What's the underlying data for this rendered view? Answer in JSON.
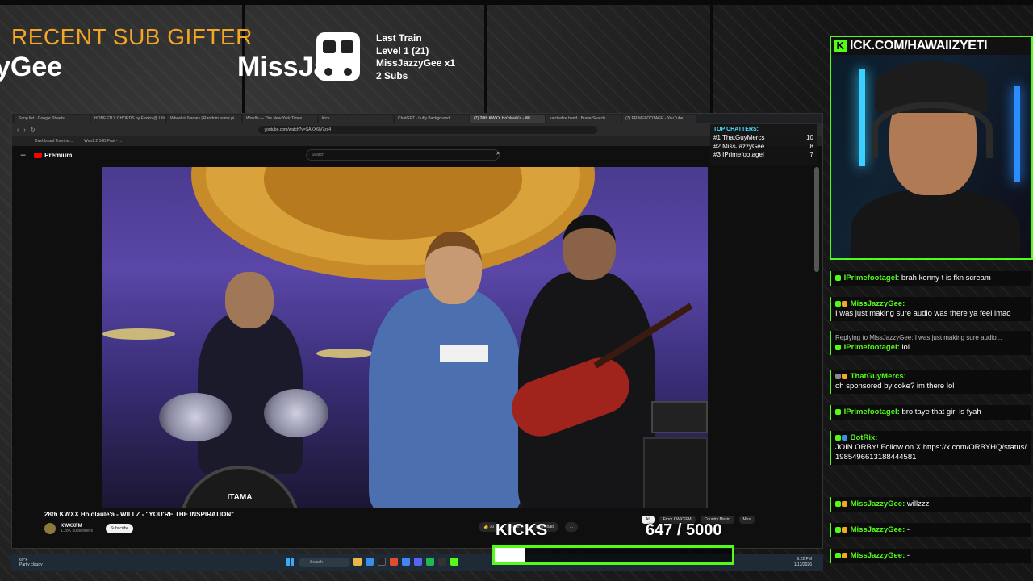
{
  "overlay": {
    "sub_gifter_title": "RECENT SUB GIFTER",
    "sub_gifter_name_left": "yGee",
    "sub_gifter_name_right": "MissJa",
    "train": {
      "title": "Last Train",
      "level": "Level 1  (21)",
      "gifter": "MissJazzyGee x1",
      "subs": "2 Subs"
    },
    "kick_url": "ICK.COM/HAWAIIZYETI",
    "kicks_label": "KICKS",
    "kicks_count": "647 / 5000",
    "kicks_progress": 0.1294
  },
  "browser": {
    "tabs": [
      "Song list - Google Sheets",
      "HONESTLY CHORDS by Eaoko @ Ulti",
      "Wheel of Names | Random name pi",
      "Wordle — The New York Times",
      "Kick",
      "ChatGPT - Luffy Background",
      "(7) 28th KWXX Ho'olaule'a - WI",
      "katchafire band - Brave Search",
      "(7) PRIMEFOOTAGE - YouTube"
    ],
    "active_tab_index": 6,
    "url": "youtube.com/watch?v=SAXX6lV7zc4",
    "bookmarks": [
      "Dashboard Tourthw...",
      "Wan2.2 14B Fast - ..."
    ]
  },
  "youtube": {
    "logo_text": "Premium",
    "search_placeholder": "Search",
    "video_title": "28th KWXX Ho'olaule'a - WILLZ - \"YOU'RE THE INSPIRATION\"",
    "channel_name": "KWXXFM",
    "channel_subs": "1.28K subscribers",
    "subscribe_label": "Subscribe",
    "like_count": "30",
    "save_label": "Save",
    "download_label": "Download",
    "more_label": "...",
    "chips": [
      "All",
      "From KWXXFM",
      "Country Music",
      "Mus"
    ],
    "kick_drum_text": "ITAMA"
  },
  "top_chatters": {
    "heading": "TOP CHATTERS:",
    "rows": [
      {
        "rank": "#1",
        "name": "ThatGuyMercs",
        "count": "10"
      },
      {
        "rank": "#2",
        "name": "MissJazzyGee",
        "count": "8"
      },
      {
        "rank": "#3",
        "name": "IPrimefootagel",
        "count": "7"
      }
    ]
  },
  "taskbar": {
    "weather_temp": "69°F",
    "weather_desc": "Partly cloudy",
    "search_placeholder": "Search",
    "time": "9:22 PM",
    "date": "1/13/2026"
  },
  "chat": {
    "messages": [
      {
        "user": "IPrimefootagel",
        "text": "brah kenny t is fkn scream",
        "inline": true
      },
      {
        "user": "MissJazzyGee:",
        "text": "I was just making sure audio was there ya feel lmao",
        "inline": false
      },
      {
        "reply": "Replying to MissJazzyGee: I was just making sure audio...",
        "user": "IPrimefootagel:",
        "text": "lol",
        "inline": true
      },
      {
        "user": "ThatGuyMercs:",
        "text": "oh sponsored by coke? im there lol",
        "inline": false
      },
      {
        "user": "IPrimefootagel:",
        "text": "bro taye that girl is fyah",
        "inline": true
      },
      {
        "user": "BotRix:",
        "text": "JOIN ORBY! Follow on X https://x.com/ORBYHQ/status/1985496613188444581",
        "inline": false
      },
      {
        "user": "MissJazzyGee:",
        "text": "willzzz",
        "inline": true
      },
      {
        "user": "MissJazzyGee:",
        "text": "-",
        "inline": true
      },
      {
        "user": "MissJazzyGee:",
        "text": "-",
        "inline": true
      }
    ]
  },
  "colors": {
    "kick_green": "#53fc18",
    "gifter_orange": "#f5a623",
    "chatters_cyan": "#46e0ff",
    "youtube_red": "#ff0000"
  }
}
